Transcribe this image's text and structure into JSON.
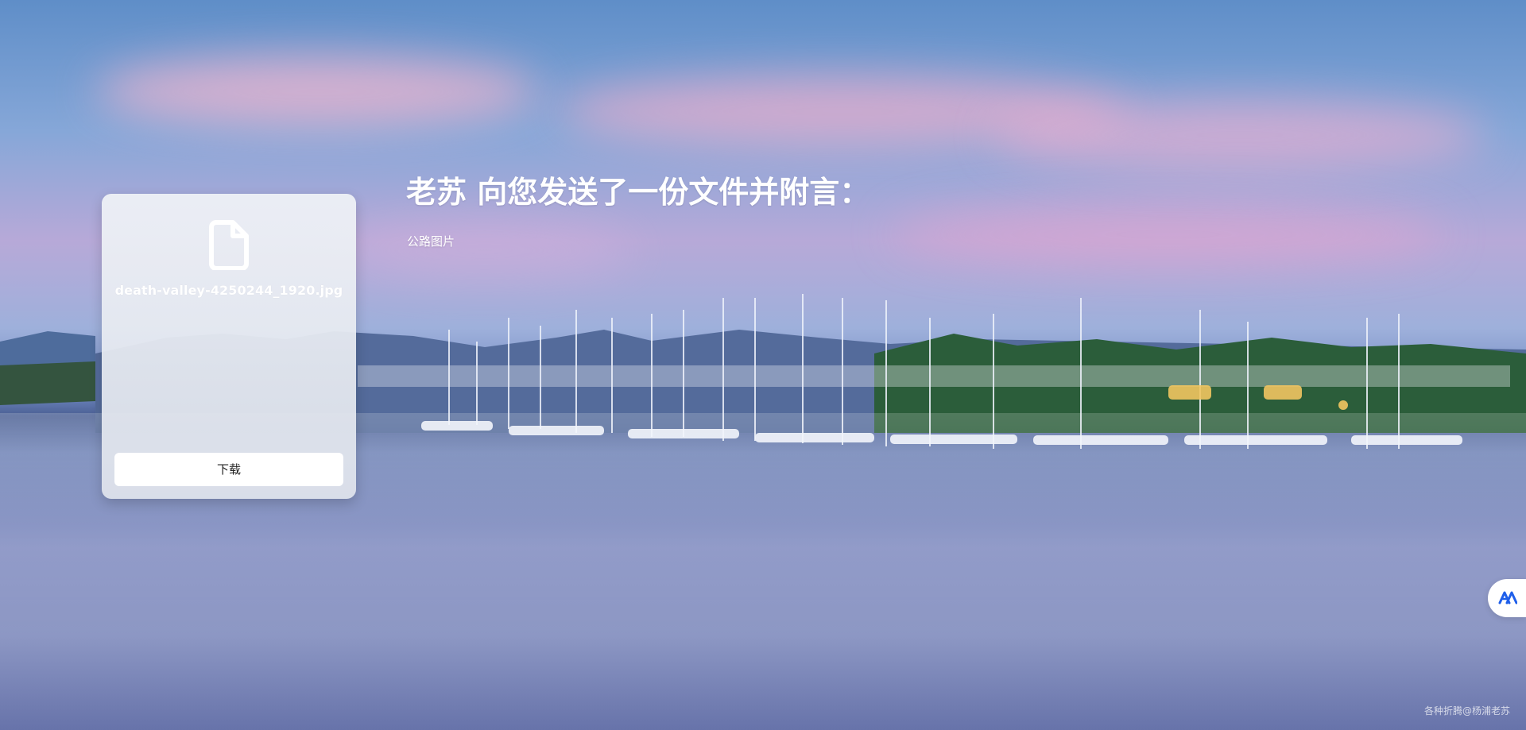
{
  "file": {
    "name": "death-valley-4250244_1920.jpg",
    "icon": "document-icon"
  },
  "actions": {
    "download_label": "下载"
  },
  "message": {
    "title": "老苏 向您发送了一份文件并附言：",
    "note": "公路图片"
  },
  "floating_button": {
    "icon": "logo-icon"
  },
  "watermark": {
    "text": "各种折腾@杨浦老苏"
  },
  "colors": {
    "card_bg": "#E6EAF1",
    "button_bg": "#FFFFFF",
    "logo_blue": "#1F5FEA",
    "text_white": "#FFFFFF"
  }
}
